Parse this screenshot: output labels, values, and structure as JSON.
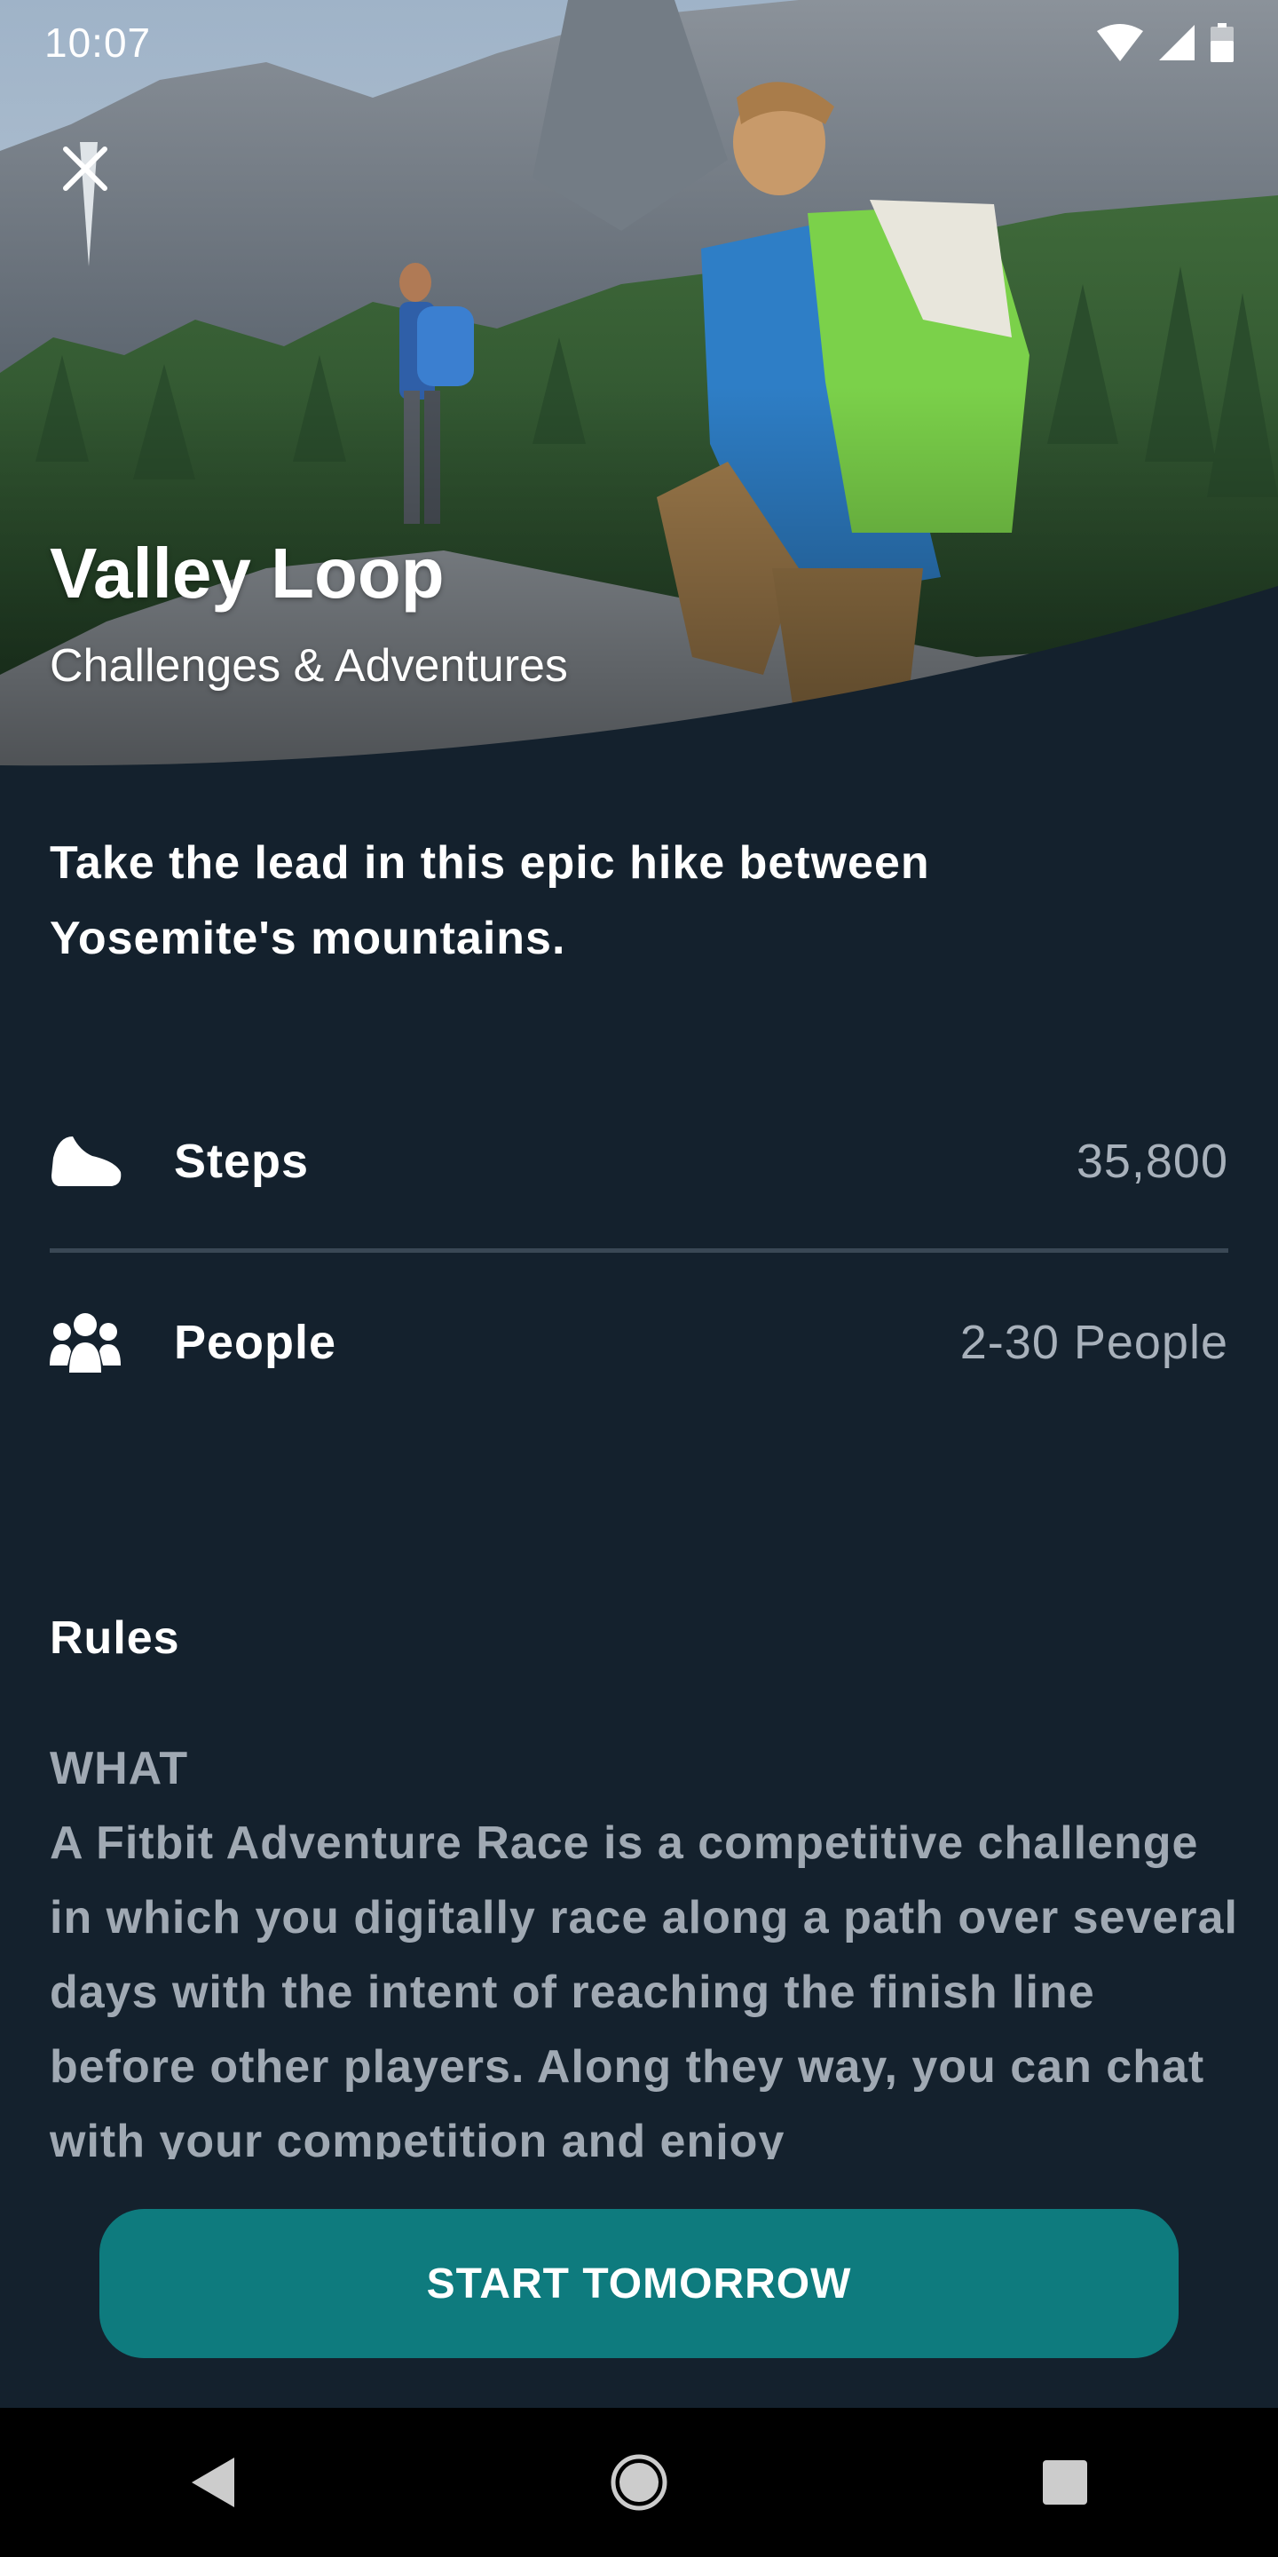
{
  "status_bar": {
    "time": "10:07",
    "icons": [
      "wifi-icon",
      "cell-signal-icon",
      "battery-icon"
    ]
  },
  "hero": {
    "close_icon": "close-icon",
    "title": "Valley Loop",
    "subtitle": "Challenges & Adventures"
  },
  "description": "Take the lead in this epic hike between Yosemite's mountains.",
  "stats": [
    {
      "icon": "shoe-icon",
      "label": "Steps",
      "value": "35,800"
    },
    {
      "icon": "people-icon",
      "label": "People",
      "value": "2-30 People"
    }
  ],
  "rules": {
    "heading": "Rules",
    "subheading": "WHAT",
    "body": "A Fitbit Adventure Race is a competitive challenge in which you digitally race along a path over several days with the intent of reaching the finish line before other players. Along they way, you can chat with your competition and enjoy"
  },
  "cta": {
    "label": "START TOMORROW"
  },
  "nav": {
    "icons": [
      "back-icon",
      "home-icon",
      "recents-icon"
    ]
  },
  "colors": {
    "background": "#14212d",
    "accent": "#0e7b7e",
    "secondary_text": "#a8b1bb"
  }
}
